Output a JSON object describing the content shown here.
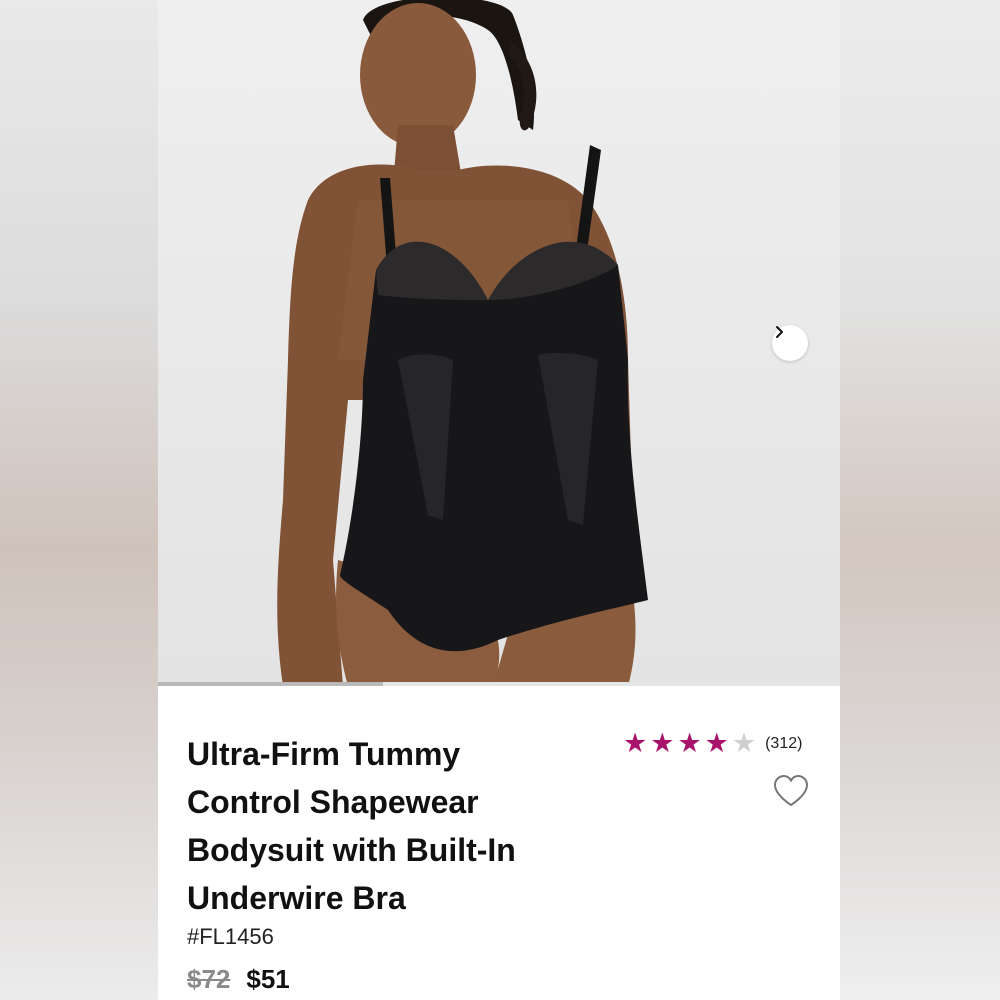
{
  "product": {
    "title": "Ultra-Firm Tummy Control Shapewear Bodysuit with Built-In Underwire Bra",
    "sku": "#FL1456",
    "original_price": "$72",
    "sale_price": "$51",
    "rating": 4,
    "rating_max": 5,
    "review_count": "(312)"
  },
  "gallery": {
    "image_alt": "Model wearing black lace bodysuit",
    "next_icon": "chevron-right-icon",
    "progress_fraction": 0.33
  },
  "icons": {
    "wishlist": "heart-outline-icon",
    "star_filled": "star-icon",
    "star_empty": "star-empty-icon"
  },
  "colors": {
    "star_filled": "#a8126b",
    "star_empty": "#cfcfcf",
    "background_card": "#ffffff",
    "text_primary": "#111111",
    "text_muted": "#8a8a8a"
  }
}
